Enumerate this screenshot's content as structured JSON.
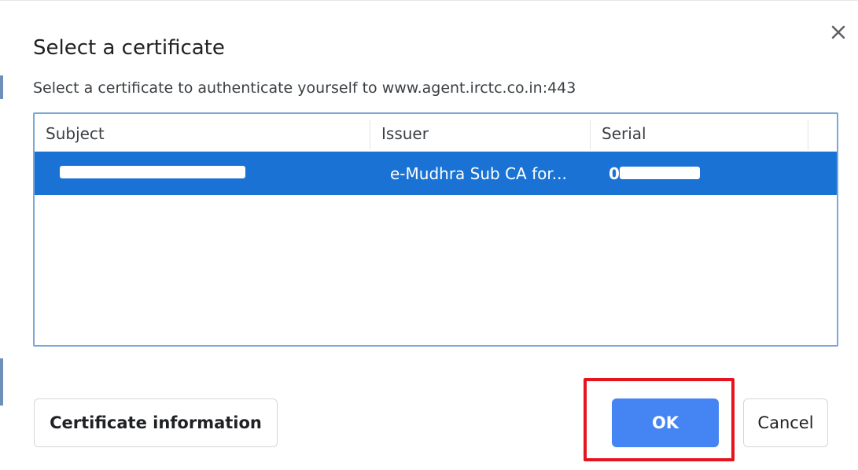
{
  "dialog": {
    "title": "Select a certificate",
    "subtitle": "Select a certificate to authenticate yourself to www.agent.irctc.co.in:443",
    "close_icon": "close-icon"
  },
  "table": {
    "columns": [
      "Subject",
      "Issuer",
      "Serial"
    ],
    "rows": [
      {
        "subject": "",
        "issuer": "e-Mudhra Sub CA for...",
        "serial": "0",
        "selected": true
      }
    ]
  },
  "buttons": {
    "certificate_information": "Certificate information",
    "ok": "OK",
    "cancel": "Cancel"
  },
  "colors": {
    "selection": "#1a73d4",
    "primary_button": "#4485f3",
    "highlight_box": "#e5141e",
    "table_border": "#7aa7d8"
  }
}
